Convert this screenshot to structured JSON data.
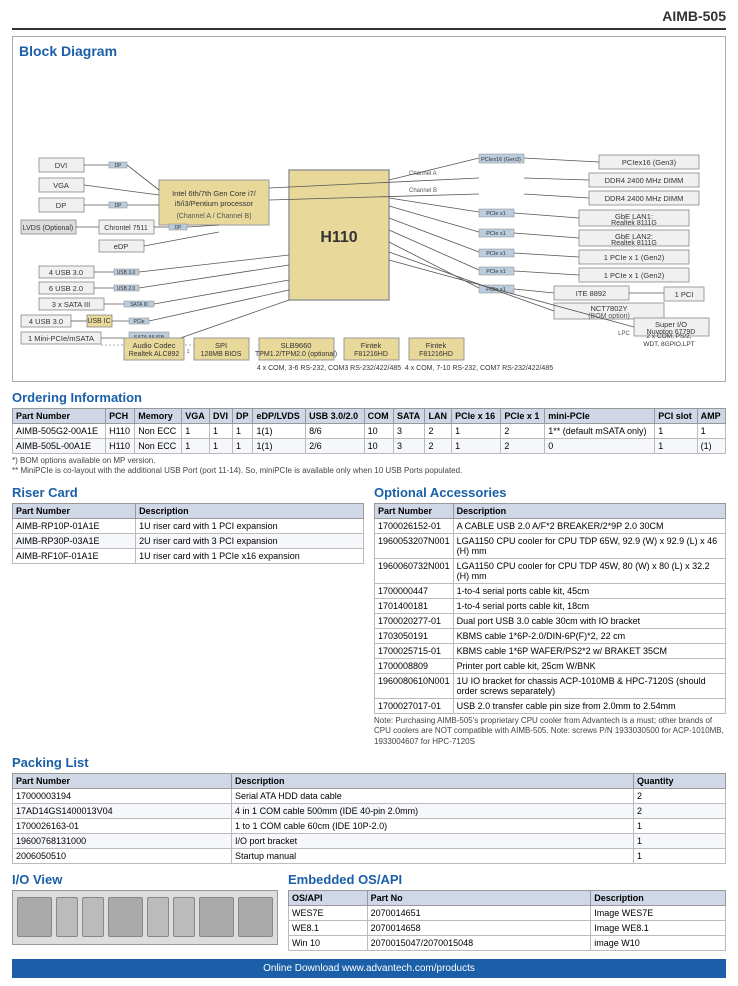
{
  "header": {
    "model": "AIMB-505"
  },
  "block_diagram": {
    "title": "Block Diagram"
  },
  "ordering": {
    "title": "Ordering Information",
    "columns": [
      "Part Number",
      "PCH",
      "Memory",
      "VGA",
      "DVI",
      "DP",
      "eDP/LVDS",
      "USB 3.0/2.0",
      "COM",
      "SATA",
      "LAN",
      "PCIe x 16",
      "PCIe x 1",
      "mini-PCIe",
      "PCI slot",
      "AMP"
    ],
    "rows": [
      [
        "AIMB-505G2-00A1E",
        "H110",
        "Non ECC",
        "1",
        "1",
        "1",
        "1(1)",
        "8/6",
        "10",
        "3",
        "2",
        "1",
        "2",
        "1** (default mSATA only)",
        "1",
        "1"
      ],
      [
        "AIMB-505L-00A1E",
        "H110",
        "Non ECC",
        "1",
        "1",
        "1",
        "1(1)",
        "2/6",
        "10",
        "3",
        "2",
        "1",
        "2",
        "0",
        "1",
        "(1)"
      ]
    ],
    "notes": [
      "*) BOM options available on MP version.",
      "** MiniPCIe is co-layout with the additional USB Port (port 11-14). So, miniPCIe is available only when 10 USB Ports populated."
    ]
  },
  "riser_card": {
    "title": "Riser Card",
    "columns": [
      "Part Number",
      "Description"
    ],
    "rows": [
      [
        "AIMB-RP10P-01A1E",
        "1U riser card with 1 PCI expansion"
      ],
      [
        "AIMB-RP30P-03A1E",
        "2U riser card with 3 PCI expansion"
      ],
      [
        "AIMB-RF10F-01A1E",
        "1U riser card with 1 PCIe x16 expansion"
      ]
    ]
  },
  "packing_list": {
    "title": "Packing List",
    "columns": [
      "Part Number",
      "Description",
      "Quantity"
    ],
    "rows": [
      [
        "17000003194",
        "Serial ATA HDD data cable",
        "2"
      ],
      [
        "17AD14GS1400013V04",
        "4 in 1 COM cable 500mm (IDE 40-pin 2.0mm)",
        "2"
      ],
      [
        "1700026163-01",
        "1 to 1 COM cable 60cm (IDE 10P-2.0)",
        "1"
      ],
      [
        "19600768131000",
        "I/O port bracket",
        "1"
      ],
      [
        "2006050510",
        "Startup manual",
        "1"
      ]
    ]
  },
  "optional_accessories": {
    "title": "Optional Accessories",
    "columns": [
      "Part Number",
      "Description"
    ],
    "rows": [
      [
        "1700026152-01",
        "A CABLE USB 2.0 A/F*2 BREAKER/2*9P 2.0 30CM"
      ],
      [
        "1960053207N001",
        "LGA1150 CPU cooler for CPU TDP 65W, 92.9 (W) x 92.9 (L) x 46 (H) mm"
      ],
      [
        "1960060732N001",
        "LGA1150 CPU cooler for CPU TDP 45W, 80 (W) x 80 (L) x 32.2 (H) mm"
      ],
      [
        "1700000447",
        "1-to-4 serial ports cable kit, 45cm"
      ],
      [
        "1701400181",
        "1-to-4 serial ports cable kit, 18cm"
      ],
      [
        "1700020277-01",
        "Dual port USB 3.0 cable 30cm with IO bracket"
      ],
      [
        "1703050191",
        "KBMS cable 1*6P-2.0/DIN-6P(F)*2, 22 cm"
      ],
      [
        "1700025715-01",
        "KBMS cable 1*6P WAFER/PS2*2 w/ BRAKET 35CM"
      ],
      [
        "1700008809",
        "Printer port cable kit, 25cm W/BNK"
      ],
      [
        "1960080610N001",
        "1U IO bracket for chassis ACP-1010MB & HPC-7120S (should order screws separately)"
      ],
      [
        "1700027017-01",
        "USB 2.0 transfer cable pin size from 2.0mm to 2.54mm"
      ]
    ],
    "note": "Note: Purchasing AIMB-505's proprietary CPU cooler from Advantech is a must; other brands of CPU coolers are NOT compatible with AIMB-505.\nNote: screws P/N\n1933030500 for ACP-1010MB, 1933004607 for HPC-7120S"
  },
  "io_view": {
    "title": "I/O View"
  },
  "embedded_os": {
    "title": "Embedded OS/API",
    "columns": [
      "OS/API",
      "Part No",
      "Description"
    ],
    "rows": [
      [
        "WES7E",
        "2070014651",
        "Image WES7E"
      ],
      [
        "WE8.1",
        "2070014658",
        "Image WE8.1"
      ],
      [
        "Win 10",
        "2070015047/2070015048",
        "image W10"
      ]
    ]
  },
  "footer": {
    "label": "Online Download",
    "url": "www.advantech.com/products"
  }
}
